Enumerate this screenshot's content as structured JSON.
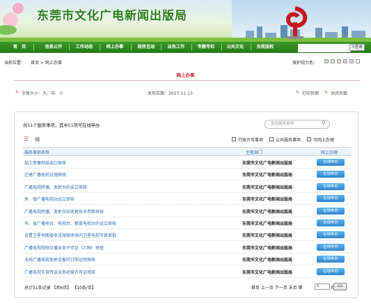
{
  "header": {
    "site_title": "东莞市文化广电新闻出版局"
  },
  "nav": {
    "items": [
      "首　页",
      "信息公开",
      "工作动态",
      "网上办事",
      "政民互动",
      "业务工作",
      "专题专栏",
      "公共文化",
      "东莞版权"
    ],
    "search_button": "查询"
  },
  "topbar": {
    "location_label": "当前位置：",
    "breadcrumb": "首页 > 网上办事",
    "mode_label": "保护视力色：",
    "swatch_colors": [
      "#c4e7c6",
      "#f7e7c2",
      "#e2e2e2",
      "#f5c6d3",
      "#c9def2",
      "#ffffff"
    ]
  },
  "page": {
    "title": "网上办事"
  },
  "meta": {
    "font_size_text": "字体大小：大、中、小",
    "publish_date": "发布日期：2017-11-13",
    "print_label": "打印页面",
    "close_label": "关闭页面"
  },
  "summary": "共51个服务事项，其中51项可在线申办",
  "search_placeholder": "查找服务事项",
  "filters": [
    "行政许可事项",
    "公共服务事项",
    "可网上办理"
  ],
  "table": {
    "headers": [
      "服务事项名称",
      "主管部门",
      "网上办理"
    ],
    "rows": [
      {
        "name": "加工音像制品出口审核",
        "dept": "东莞市文化广电新闻出版局",
        "action": "在线申办"
      },
      {
        "name": "迁建广播电视设施审核",
        "dept": "东莞市文化广电新闻出版局",
        "action": "在线申办"
      },
      {
        "name": "广播电视转播、发射台的设立审核",
        "dept": "东莞市文化广电新闻出版局",
        "action": "在线申办"
      },
      {
        "name": "乡、镇广播电视站设立审核",
        "dept": "东莞市文化广电新闻出版局",
        "action": "在线申办"
      },
      {
        "name": "广播电视转播、发射台站变更技术参数审核",
        "dept": "东莞市文化广电新闻出版局",
        "action": "在线申办"
      },
      {
        "name": "市、县广播电台、电视台、教育电视台的设立审核",
        "dept": "东莞市文化广电新闻出版局",
        "action": "在线申办"
      },
      {
        "name": "设置卫星地面接收设施接收境内卫星电视节目审批",
        "dept": "东莞市文化广电新闻出版局",
        "action": "在线申办"
      },
      {
        "name": "广播电视视频点播业务许可证（乙种）审批",
        "dept": "东莞市文化广电新闻出版局",
        "action": "在线申办"
      },
      {
        "name": "无线广播电视发射设备的订购证明审核",
        "dept": "东莞市文化广电新闻出版局",
        "action": "在线申办"
      },
      {
        "name": "广播电视节目传送业务经营许可证审核",
        "dept": "东莞市文化广电新闻出版局",
        "action": "在线申办"
      }
    ]
  },
  "pagination": {
    "record_info": "总计51条记录 【共6页】 【10条/页】",
    "nav_text": "首页 上一页 下一页 末页 第",
    "page_value": "1",
    "page_unit": "页",
    "go_label": "GO"
  }
}
